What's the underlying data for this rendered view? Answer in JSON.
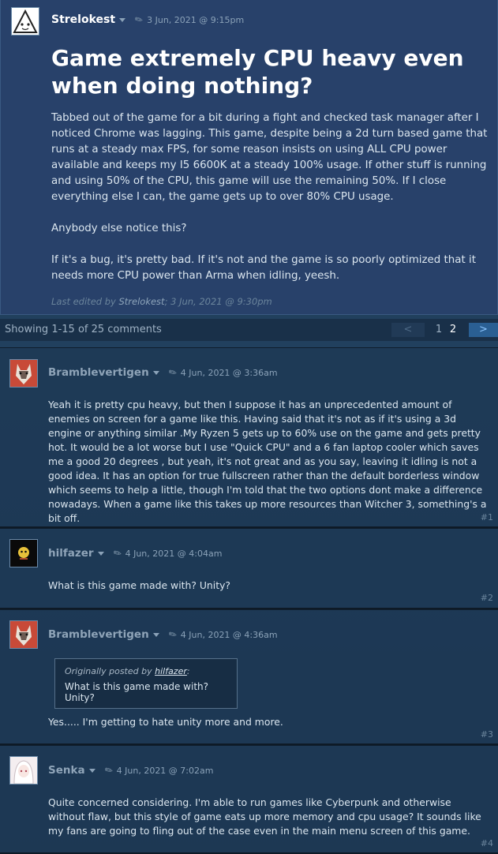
{
  "op": {
    "author": "Strelokest",
    "date": "3 Jun, 2021 @ 9:15pm",
    "title": "Game extremely CPU heavy even when doing nothing?",
    "paragraphs": [
      "Tabbed out of the game for a bit during a fight and checked task manager after I noticed Chrome was lagging. This game, despite being a 2d turn based game that runs at a steady max FPS, for some reason insists on using ALL CPU power available and keeps my I5 6600K at a steady 100% usage. If other stuff is running and using 50% of the CPU, this game will use the remaining 50%. If I close everything else I can, the game gets up to over 80% CPU usage.",
      "Anybody else notice this?",
      "If it's a bug, it's pretty bad. If it's not and the game is so poorly optimized that it needs more CPU power than Arma when idling, yeesh."
    ],
    "edited_prefix": "Last edited by ",
    "edited_by": "Strelokest",
    "edited_suffix": "; 3 Jun, 2021 @ 9:30pm"
  },
  "paging": {
    "showing": "Showing 1-15 of 25 comments",
    "prev": "<",
    "page1": "1",
    "page2": "2",
    "next": ">"
  },
  "comments": [
    {
      "author": "Bramblevertigen",
      "date": "4 Jun, 2021 @ 3:36am",
      "text": "Yeah it is pretty cpu heavy, but then I suppose it has an unprecedented amount of enemies on screen for a game like this. Having said that it's not as if it's using a 3d engine or anything similar .My Ryzen 5 gets up to 60% use on the game and gets pretty hot. It would be a lot worse but I use \"Quick CPU\" and a 6 fan laptop cooler which saves me a good 20 degrees , but yeah, it's not great and as you say, leaving it idling is not a good idea. It has an option for true fullscreen rather than the default borderless window which seems to help a little, though I'm told that the two options dont make a difference nowadays. When a game like this takes up more resources than Witcher 3, something's a bit off.",
      "num": "#1"
    },
    {
      "author": "hilfazer",
      "date": "4 Jun, 2021 @ 4:04am",
      "text": "What is this game made with? Unity?",
      "num": "#2"
    },
    {
      "author": "Bramblevertigen",
      "date": "4 Jun, 2021 @ 4:36am",
      "quote_prefix": "Originally posted by ",
      "quote_author": "hilfazer",
      "quote_suffix": ":",
      "quote_text": "What is this game made with? Unity?",
      "text": "Yes..... I'm getting to hate unity more and more.",
      "num": "#3"
    },
    {
      "author": "Senka",
      "date": "4 Jun, 2021 @ 7:02am",
      "text": "Quite concerned considering. I'm able to run games like Cyberpunk and otherwise without flaw, but this style of game eats up more memory and cpu usage? It sounds like my fans are going to fling out of the case even in the main menu screen of this game.",
      "num": "#4"
    }
  ]
}
